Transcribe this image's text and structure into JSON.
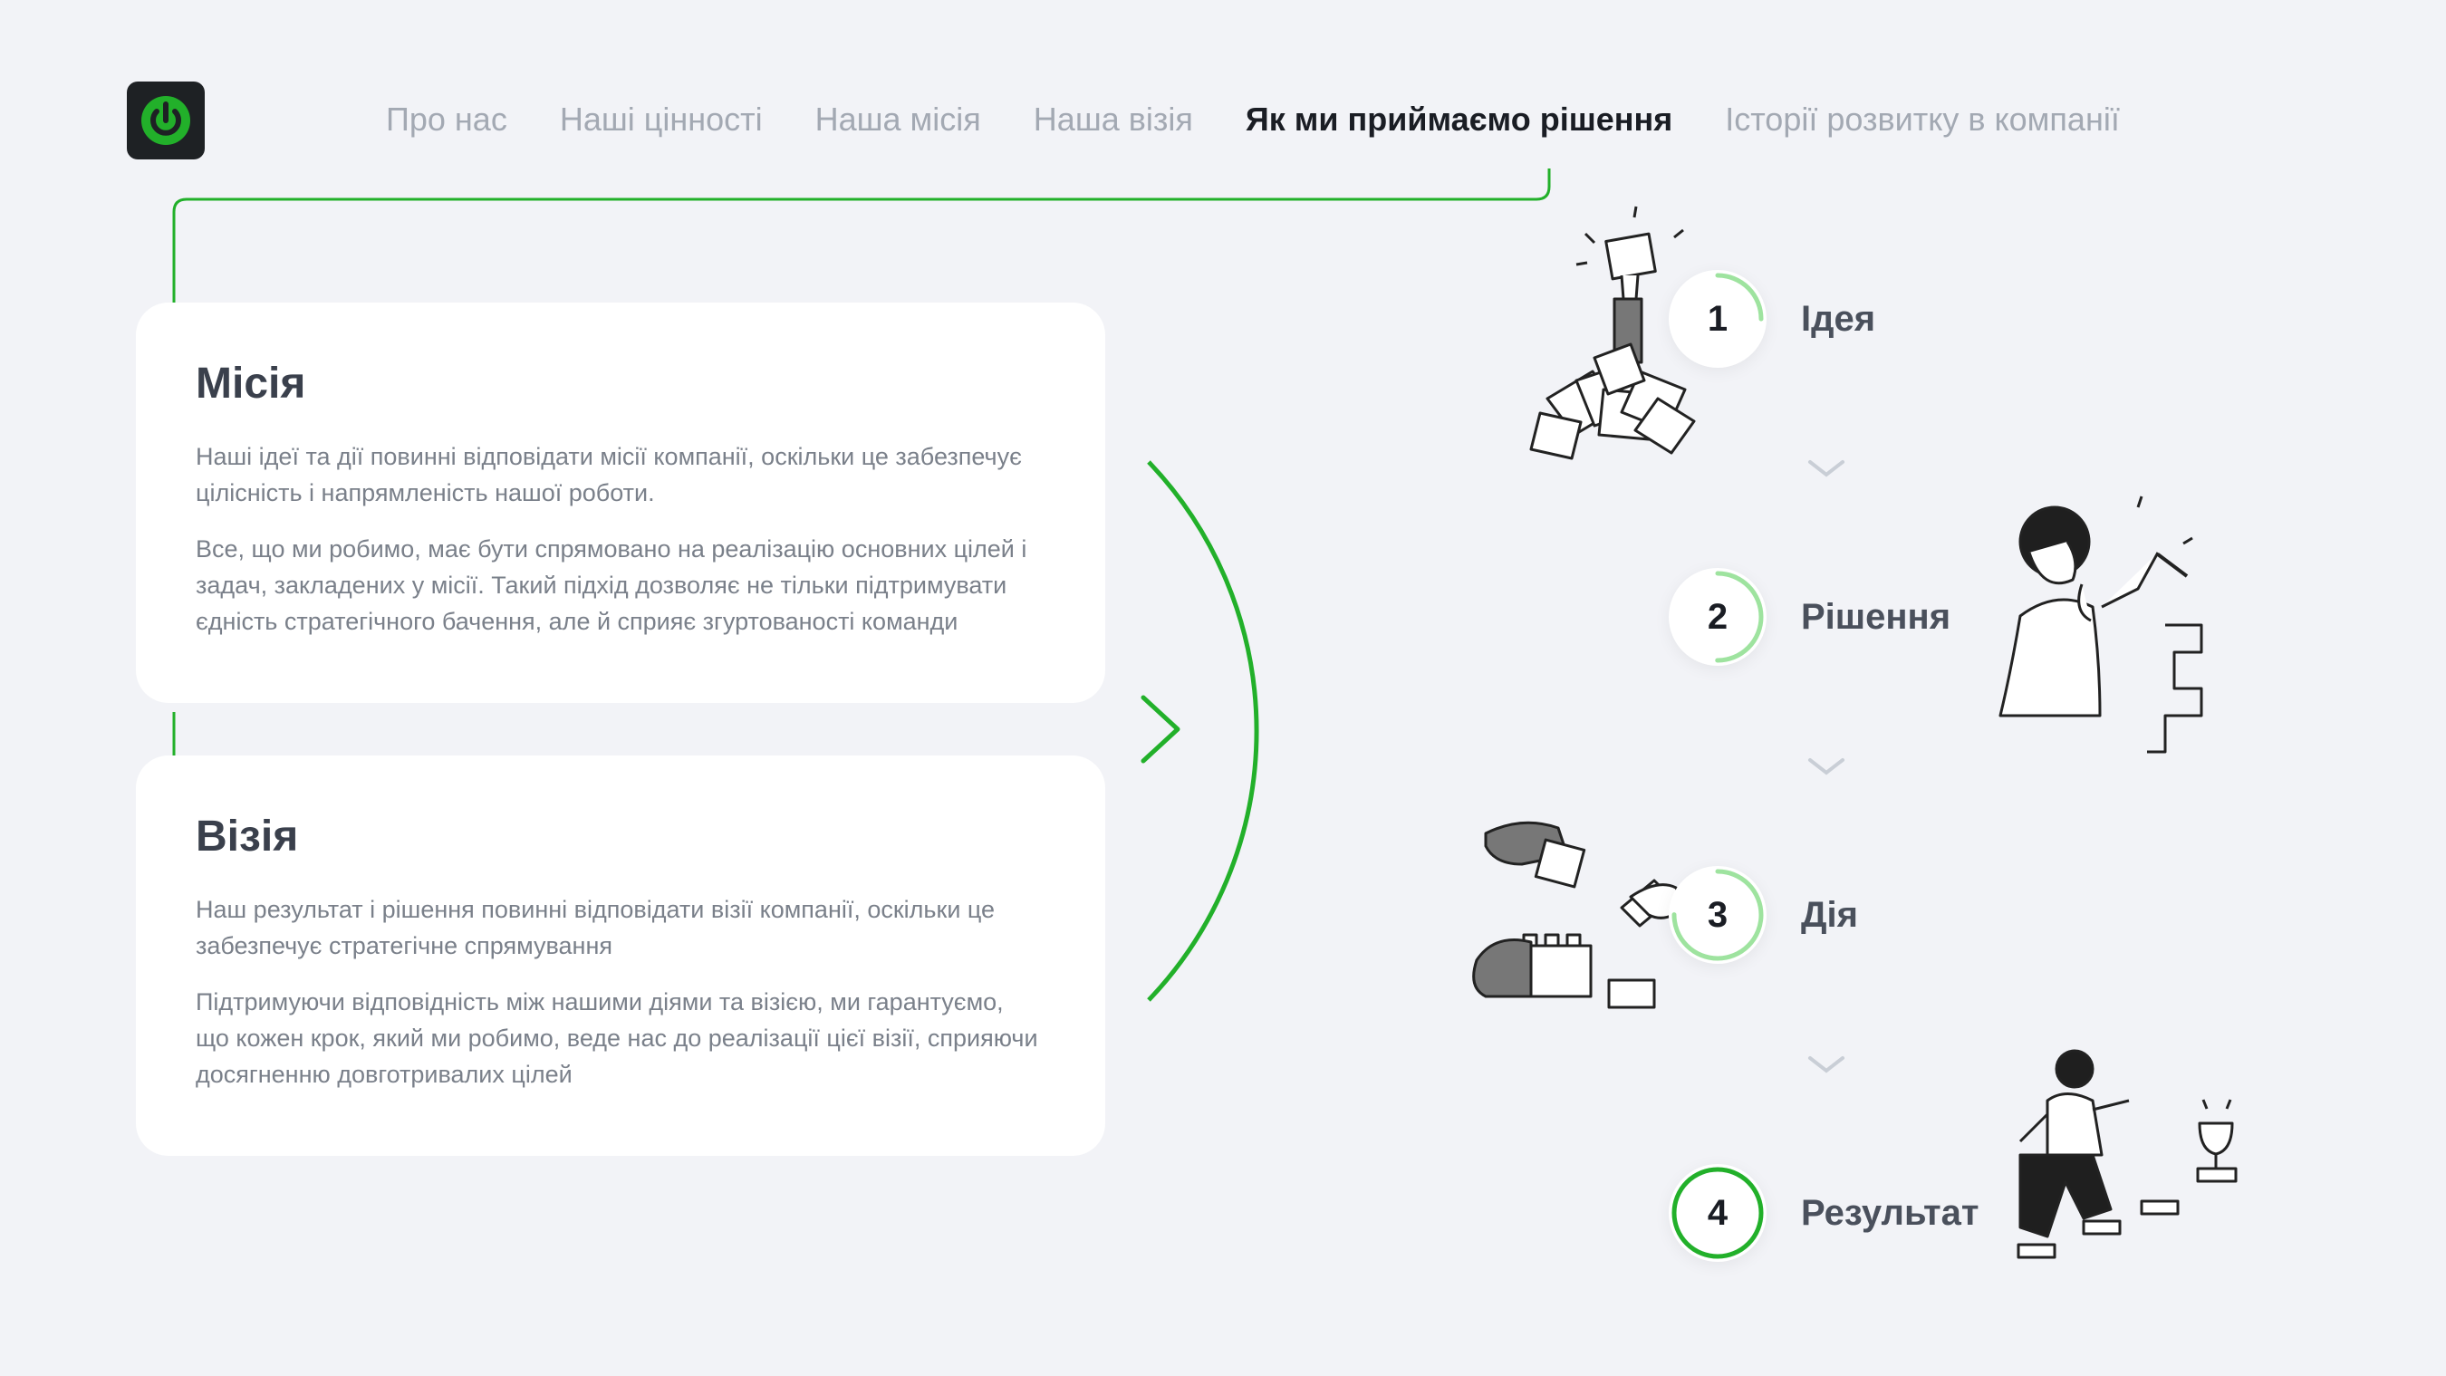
{
  "header": {
    "logo_icon": "power-icon",
    "nav": [
      {
        "label": "Про нас",
        "active": false
      },
      {
        "label": "Наші цінності",
        "active": false
      },
      {
        "label": "Наша місія",
        "active": false
      },
      {
        "label": "Наша візія",
        "active": false
      },
      {
        "label": "Як ми приймаємо рішення",
        "active": true
      },
      {
        "label": "Історії розвитку в компанії",
        "active": false
      }
    ]
  },
  "mission": {
    "title": "Місія",
    "p1": "Наші ідеї та дії повинні відповідати місії компанії, оскільки це забезпечує цілісність і напрямленість нашої роботи.",
    "p2": "Все, що ми робимо, має бути спрямовано на реалізацію основних цілей і задач, закладених у місії. Такий підхід дозволяє не тільки підтримувати єдність стратегічного бачення, але й сприяє згуртованості команди"
  },
  "vision": {
    "title": "Візія",
    "p1": "Наш результат і рішення повинні відповідати візії компанії, оскільки це забезпечує стратегічне спрямування",
    "p2": "Підтримуючи відповідність між нашими діями та візією, ми гарантуємо, що кожен крок, який ми робимо, веде нас до реалізації цієї візії, сприяючи досягненню довготривалих цілей"
  },
  "steps": [
    {
      "number": "1",
      "label": "Ідея",
      "progress": 0.25
    },
    {
      "number": "2",
      "label": "Рішення",
      "progress": 0.5
    },
    {
      "number": "3",
      "label": "Дія",
      "progress": 0.75
    },
    {
      "number": "4",
      "label": "Результат",
      "progress": 1.0
    }
  ],
  "colors": {
    "accent": "#22b02a",
    "accent_light": "#9ee39f",
    "background": "#f2f3f7",
    "card": "#ffffff",
    "logo_bg": "#1e2124"
  }
}
